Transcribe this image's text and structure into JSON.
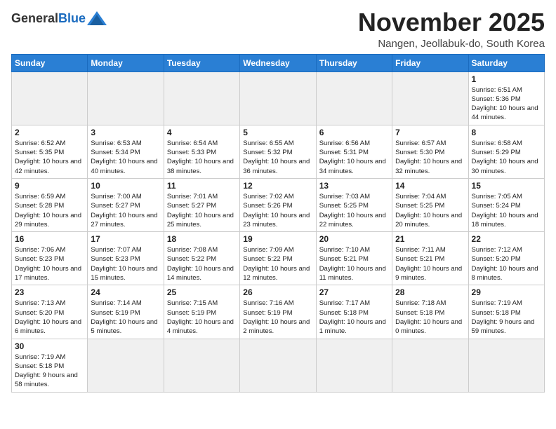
{
  "logo": {
    "general": "General",
    "blue": "Blue"
  },
  "header": {
    "title": "November 2025",
    "subtitle": "Nangen, Jeollabuk-do, South Korea"
  },
  "weekdays": [
    "Sunday",
    "Monday",
    "Tuesday",
    "Wednesday",
    "Thursday",
    "Friday",
    "Saturday"
  ],
  "weeks": [
    [
      {
        "day": null,
        "text": null
      },
      {
        "day": null,
        "text": null
      },
      {
        "day": null,
        "text": null
      },
      {
        "day": null,
        "text": null
      },
      {
        "day": null,
        "text": null
      },
      {
        "day": null,
        "text": null
      },
      {
        "day": "1",
        "text": "Sunrise: 6:51 AM\nSunset: 5:36 PM\nDaylight: 10 hours and 44 minutes."
      }
    ],
    [
      {
        "day": "2",
        "text": "Sunrise: 6:52 AM\nSunset: 5:35 PM\nDaylight: 10 hours and 42 minutes."
      },
      {
        "day": "3",
        "text": "Sunrise: 6:53 AM\nSunset: 5:34 PM\nDaylight: 10 hours and 40 minutes."
      },
      {
        "day": "4",
        "text": "Sunrise: 6:54 AM\nSunset: 5:33 PM\nDaylight: 10 hours and 38 minutes."
      },
      {
        "day": "5",
        "text": "Sunrise: 6:55 AM\nSunset: 5:32 PM\nDaylight: 10 hours and 36 minutes."
      },
      {
        "day": "6",
        "text": "Sunrise: 6:56 AM\nSunset: 5:31 PM\nDaylight: 10 hours and 34 minutes."
      },
      {
        "day": "7",
        "text": "Sunrise: 6:57 AM\nSunset: 5:30 PM\nDaylight: 10 hours and 32 minutes."
      },
      {
        "day": "8",
        "text": "Sunrise: 6:58 AM\nSunset: 5:29 PM\nDaylight: 10 hours and 30 minutes."
      }
    ],
    [
      {
        "day": "9",
        "text": "Sunrise: 6:59 AM\nSunset: 5:28 PM\nDaylight: 10 hours and 29 minutes."
      },
      {
        "day": "10",
        "text": "Sunrise: 7:00 AM\nSunset: 5:27 PM\nDaylight: 10 hours and 27 minutes."
      },
      {
        "day": "11",
        "text": "Sunrise: 7:01 AM\nSunset: 5:27 PM\nDaylight: 10 hours and 25 minutes."
      },
      {
        "day": "12",
        "text": "Sunrise: 7:02 AM\nSunset: 5:26 PM\nDaylight: 10 hours and 23 minutes."
      },
      {
        "day": "13",
        "text": "Sunrise: 7:03 AM\nSunset: 5:25 PM\nDaylight: 10 hours and 22 minutes."
      },
      {
        "day": "14",
        "text": "Sunrise: 7:04 AM\nSunset: 5:25 PM\nDaylight: 10 hours and 20 minutes."
      },
      {
        "day": "15",
        "text": "Sunrise: 7:05 AM\nSunset: 5:24 PM\nDaylight: 10 hours and 18 minutes."
      }
    ],
    [
      {
        "day": "16",
        "text": "Sunrise: 7:06 AM\nSunset: 5:23 PM\nDaylight: 10 hours and 17 minutes."
      },
      {
        "day": "17",
        "text": "Sunrise: 7:07 AM\nSunset: 5:23 PM\nDaylight: 10 hours and 15 minutes."
      },
      {
        "day": "18",
        "text": "Sunrise: 7:08 AM\nSunset: 5:22 PM\nDaylight: 10 hours and 14 minutes."
      },
      {
        "day": "19",
        "text": "Sunrise: 7:09 AM\nSunset: 5:22 PM\nDaylight: 10 hours and 12 minutes."
      },
      {
        "day": "20",
        "text": "Sunrise: 7:10 AM\nSunset: 5:21 PM\nDaylight: 10 hours and 11 minutes."
      },
      {
        "day": "21",
        "text": "Sunrise: 7:11 AM\nSunset: 5:21 PM\nDaylight: 10 hours and 9 minutes."
      },
      {
        "day": "22",
        "text": "Sunrise: 7:12 AM\nSunset: 5:20 PM\nDaylight: 10 hours and 8 minutes."
      }
    ],
    [
      {
        "day": "23",
        "text": "Sunrise: 7:13 AM\nSunset: 5:20 PM\nDaylight: 10 hours and 6 minutes."
      },
      {
        "day": "24",
        "text": "Sunrise: 7:14 AM\nSunset: 5:19 PM\nDaylight: 10 hours and 5 minutes."
      },
      {
        "day": "25",
        "text": "Sunrise: 7:15 AM\nSunset: 5:19 PM\nDaylight: 10 hours and 4 minutes."
      },
      {
        "day": "26",
        "text": "Sunrise: 7:16 AM\nSunset: 5:19 PM\nDaylight: 10 hours and 2 minutes."
      },
      {
        "day": "27",
        "text": "Sunrise: 7:17 AM\nSunset: 5:18 PM\nDaylight: 10 hours and 1 minute."
      },
      {
        "day": "28",
        "text": "Sunrise: 7:18 AM\nSunset: 5:18 PM\nDaylight: 10 hours and 0 minutes."
      },
      {
        "day": "29",
        "text": "Sunrise: 7:19 AM\nSunset: 5:18 PM\nDaylight: 9 hours and 59 minutes."
      }
    ],
    [
      {
        "day": "30",
        "text": "Sunrise: 7:19 AM\nSunset: 5:18 PM\nDaylight: 9 hours and 58 minutes."
      },
      {
        "day": null,
        "text": null
      },
      {
        "day": null,
        "text": null
      },
      {
        "day": null,
        "text": null
      },
      {
        "day": null,
        "text": null
      },
      {
        "day": null,
        "text": null
      },
      {
        "day": null,
        "text": null
      }
    ]
  ]
}
